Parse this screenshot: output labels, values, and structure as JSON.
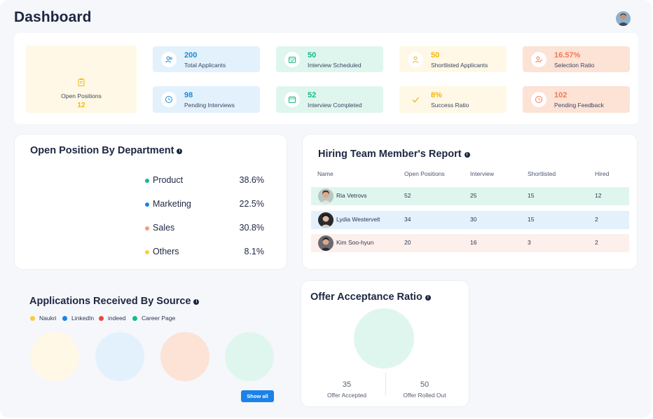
{
  "page_title": "Dashboard",
  "stats": {
    "open_positions": {
      "label": "Open Positions",
      "value": "12"
    },
    "tiles": [
      {
        "value": "200",
        "label": "Total Applicants",
        "icon": "users-icon",
        "tone": "blue"
      },
      {
        "value": "50",
        "label": "Interview Scheduled",
        "icon": "calendar-check-icon",
        "tone": "green"
      },
      {
        "value": "50",
        "label": "Shortlisted Applicants",
        "icon": "user-icon",
        "tone": "yellow"
      },
      {
        "value": "16.57%",
        "label": "Selection Ratio",
        "icon": "user-check-icon",
        "tone": "orange"
      },
      {
        "value": "98",
        "label": "Pending Interviews",
        "icon": "clock-icon",
        "tone": "blue"
      },
      {
        "value": "52",
        "label": "Interview Completed",
        "icon": "calendar-done-icon",
        "tone": "green"
      },
      {
        "value": "8%",
        "label": "Success Ratio",
        "icon": "checkmark-icon",
        "tone": "yellow"
      },
      {
        "value": "102",
        "label": "Pending Feedback",
        "icon": "clock-icon",
        "tone": "orange"
      }
    ]
  },
  "open_by_department": {
    "title": "Open Position By Department",
    "items": [
      {
        "name": "Product",
        "pct": "38.6%",
        "color": "#17b88a"
      },
      {
        "name": "Marketing",
        "pct": "22.5%",
        "color": "#1a82e8"
      },
      {
        "name": "Sales",
        "pct": "30.8%",
        "color": "#f59b7f"
      },
      {
        "name": "Others",
        "pct": "8.1%",
        "color": "#f7cf3b"
      }
    ]
  },
  "hiring_team": {
    "title": "Hiring Team Member's Report",
    "headers": [
      "Name",
      "Open Positions",
      "Interview",
      "Shortlisted",
      "Hired"
    ],
    "rows": [
      {
        "name": "Ria Vetrovs",
        "open": "52",
        "interview": "25",
        "shortlisted": "15",
        "hired": "12",
        "bg": "#dff6ee"
      },
      {
        "name": "Lydia Westervelt",
        "open": "34",
        "interview": "30",
        "shortlisted": "15",
        "hired": "2",
        "bg": "#e3f1fd"
      },
      {
        "name": "Kim Soo-hyun",
        "open": "20",
        "interview": "16",
        "shortlisted": "3",
        "hired": "2",
        "bg": "#fdf0ec"
      }
    ]
  },
  "applications_by_source": {
    "title": "Applications Received By Source",
    "legend": [
      {
        "name": "Naukri",
        "color": "#f7cf3b"
      },
      {
        "name": "LinkedIn",
        "color": "#1a82e8"
      },
      {
        "name": "indeed",
        "color": "#f0433a"
      },
      {
        "name": "Career Page",
        "color": "#17b88a"
      }
    ],
    "circle_colors": [
      "#fff8e6",
      "#e3f1fd",
      "#fde2d6",
      "#dff6ee"
    ],
    "show_all_label": "Show all"
  },
  "offer_acceptance": {
    "title": "Offer Acceptance Ratio",
    "accepted_value": "35",
    "accepted_label": "Offer Accepted",
    "rolled_out_value": "50",
    "rolled_out_label": "Offer Rolled Out",
    "circle_color": "#dff6ee"
  }
}
